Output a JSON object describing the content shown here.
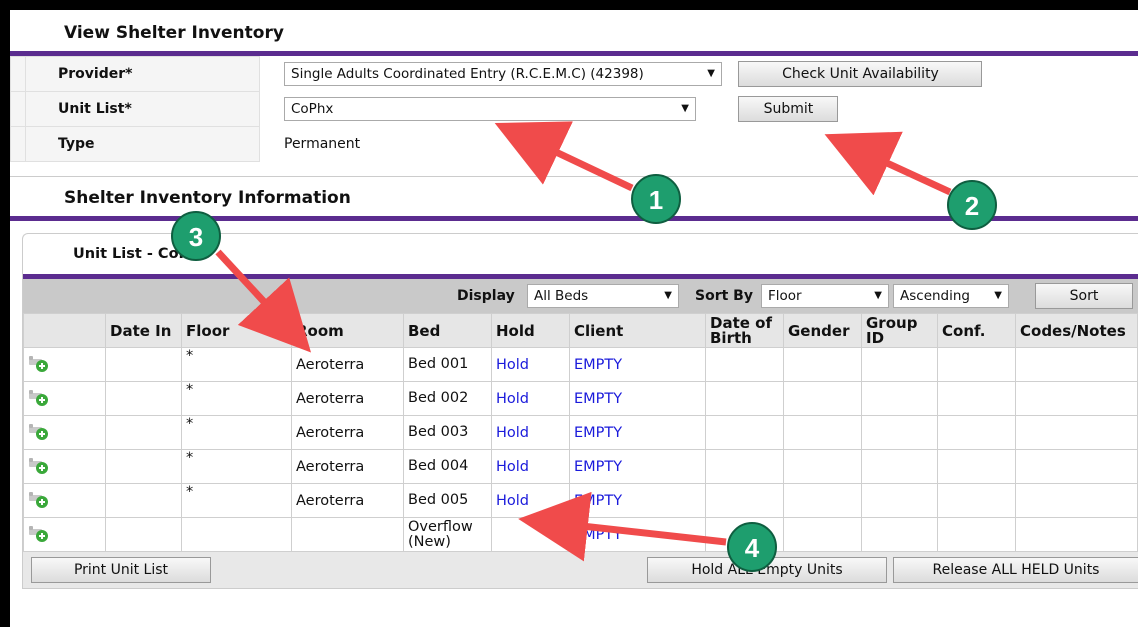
{
  "view": {
    "title": "View Shelter Inventory",
    "provider_label": "Provider",
    "provider_value": "Single Adults Coordinated Entry (R.C.E.M.C) (42398)",
    "check_button": "Check Unit Availability",
    "unit_list_label": "Unit List",
    "unit_list_value": "CoPhx",
    "submit_button": "Submit",
    "type_label": "Type",
    "type_value": "Permanent",
    "required_mark": "*"
  },
  "info": {
    "title": "Shelter Inventory Information",
    "unit_list_title": "Unit List - CoPhx"
  },
  "toolbar": {
    "display_label": "Display",
    "display_value": "All Beds",
    "sort_by_label": "Sort By",
    "sort_by_value": "Floor",
    "order_value": "Ascending",
    "sort_button": "Sort"
  },
  "columns": [
    "",
    "Date In",
    "Floor",
    "Room",
    "Bed",
    "Hold",
    "Client",
    "Date of Birth",
    "Gender",
    "Group ID",
    "Conf.",
    "Codes/Notes"
  ],
  "rows": [
    {
      "floor": "*",
      "room": "Aeroterra",
      "bed": "Bed 001",
      "hold": "Hold",
      "client": "EMPTY"
    },
    {
      "floor": "*",
      "room": "Aeroterra",
      "bed": "Bed 002",
      "hold": "Hold",
      "client": "EMPTY"
    },
    {
      "floor": "*",
      "room": "Aeroterra",
      "bed": "Bed 003",
      "hold": "Hold",
      "client": "EMPTY"
    },
    {
      "floor": "*",
      "room": "Aeroterra",
      "bed": "Bed 004",
      "hold": "Hold",
      "client": "EMPTY"
    },
    {
      "floor": "*",
      "room": "Aeroterra",
      "bed": "Bed 005",
      "hold": "Hold",
      "client": "EMPTY"
    },
    {
      "floor": "",
      "room": "",
      "bed": "Overflow (New)",
      "hold": "",
      "client": "EMPTY"
    }
  ],
  "footer": {
    "print_button": "Print Unit List",
    "hold_all_button": "Hold ALL Empty Units",
    "release_all_button": "Release ALL HELD Units"
  },
  "callouts": [
    "1",
    "2",
    "3",
    "4"
  ],
  "colors": {
    "accent": "#5b2c8f",
    "link": "#1a1adb",
    "callout": "#1e9e6e",
    "arrow": "#f04b4b"
  }
}
